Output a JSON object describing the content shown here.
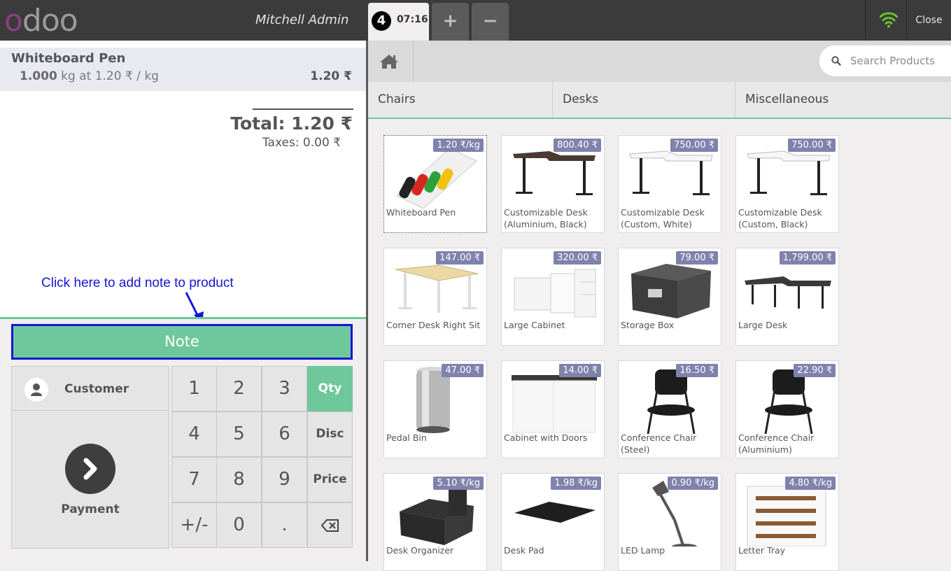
{
  "header": {
    "logo_first": "o",
    "logo_rest": "doo",
    "user": "Mitchell Admin",
    "order_number": "4",
    "order_time": "07:16",
    "add_order": "+",
    "remove_order": "−",
    "close": "Close",
    "wifi_color": "#6ac134"
  },
  "order": {
    "line": {
      "product": "Whiteboard Pen",
      "qty": "1.000",
      "unit_info": " kg at 1.20 ₹ / kg",
      "price": "1.20 ₹"
    },
    "total": "Total: 1.20 ₹",
    "taxes": "Taxes: 0.00 ₹"
  },
  "annotation": "Click here to add note to product",
  "note_button": "Note",
  "actionpad": {
    "customer": "Customer",
    "payment": "Payment"
  },
  "numpad": [
    "1",
    "2",
    "3",
    "Qty",
    "4",
    "5",
    "6",
    "Disc",
    "7",
    "8",
    "9",
    "Price",
    "+/-",
    "0",
    ".",
    "⌫"
  ],
  "search_placeholder": "Search Products",
  "categories": [
    "Chairs",
    "Desks",
    "Miscellaneous"
  ],
  "products": [
    {
      "name": "Whiteboard Pen",
      "price": "1.20 ₹/kg"
    },
    {
      "name": "Customizable Desk (Aluminium, Black)",
      "price": "800.40 ₹"
    },
    {
      "name": "Customizable Desk (Custom, White)",
      "price": "750.00 ₹"
    },
    {
      "name": "Customizable Desk (Custom, Black)",
      "price": "750.00 ₹"
    },
    {
      "name": "Corner Desk Right Sit",
      "price": "147.00 ₹"
    },
    {
      "name": "Large Cabinet",
      "price": "320.00 ₹"
    },
    {
      "name": "Storage Box",
      "price": "79.00 ₹"
    },
    {
      "name": "Large Desk",
      "price": "1,799.00 ₹"
    },
    {
      "name": "Pedal Bin",
      "price": "47.00 ₹"
    },
    {
      "name": "Cabinet with Doors",
      "price": "14.00 ₹"
    },
    {
      "name": "Conference Chair (Steel)",
      "price": "16.50 ₹"
    },
    {
      "name": "Conference Chair (Aluminium)",
      "price": "22.90 ₹"
    },
    {
      "name": "Desk Organizer",
      "price": "5.10 ₹/kg"
    },
    {
      "name": "Desk Pad",
      "price": "1.98 ₹/kg"
    },
    {
      "name": "LED Lamp",
      "price": "0.90 ₹/kg"
    },
    {
      "name": "Letter Tray",
      "price": "4.80 ₹/kg"
    }
  ],
  "colors": {
    "accent": "#6ec89b",
    "price_tag": "#7f82ac",
    "header": "#3b3b3b",
    "annotation": "#1515d8"
  }
}
